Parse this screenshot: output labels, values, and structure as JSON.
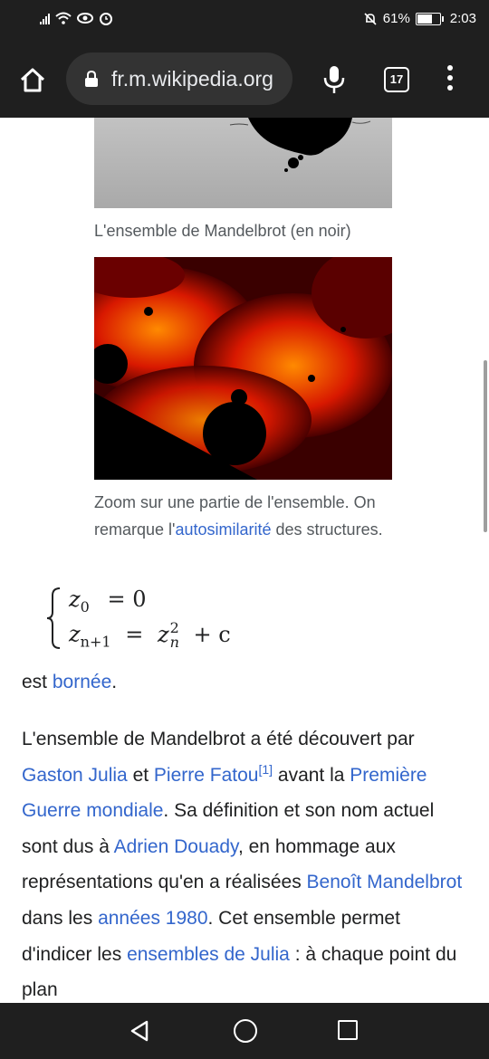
{
  "status_bar": {
    "battery": "61%",
    "time": "2:03"
  },
  "browser": {
    "url": "fr.m.wikipedia.org",
    "tab_count": "17"
  },
  "figure1": {
    "caption": "L'ensemble de Mandelbrot (en noir)"
  },
  "figure2": {
    "caption_before": "Zoom sur une partie de l'ensemble. On remarque l'",
    "caption_link": "autosimilarité",
    "caption_after": " des structures."
  },
  "formula": {
    "line1_lhs": "z",
    "line1_sub": "0",
    "line1_rhs": "= 0",
    "line2_lhs": "z",
    "line2_sub": "n+1",
    "line2_eq": "=",
    "line2_z": "z",
    "line2_sup": "2",
    "line2_sub2": "n",
    "line2_tail": "+ c"
  },
  "paragraph1": {
    "text": "est ",
    "link": "bornée",
    "end": "."
  },
  "paragraph2": {
    "t1": "L'ensemble de Mandelbrot a été découvert par ",
    "l1": "Gaston Julia",
    "t2": " et ",
    "l2": "Pierre Fatou",
    "ref": "[1]",
    "t3": " avant la ",
    "l3": "Première Guerre mondiale",
    "t4": ". Sa définition et son nom actuel sont dus à ",
    "l4": "Adrien Douady",
    "t5": ", en hommage aux représentations qu'en a réalisées ",
    "l5": "Benoît Mandelbrot",
    "t6": " dans les ",
    "l6": "années 1980",
    "t7": ". Cet ensemble permet d'indicer les ",
    "l7": "ensembles de Julia",
    "t8": " : à chaque point du plan"
  },
  "icons": {
    "home": "home-icon",
    "lock": "lock-icon",
    "mic": "mic-icon",
    "menu": "more-vert-icon",
    "back": "nav-back-icon",
    "nav_home": "nav-home-icon",
    "recents": "nav-recents-icon"
  },
  "colors": {
    "link": "#3366cc",
    "chrome": "#1f1f1f",
    "text": "#202122",
    "caption": "#54595d"
  }
}
